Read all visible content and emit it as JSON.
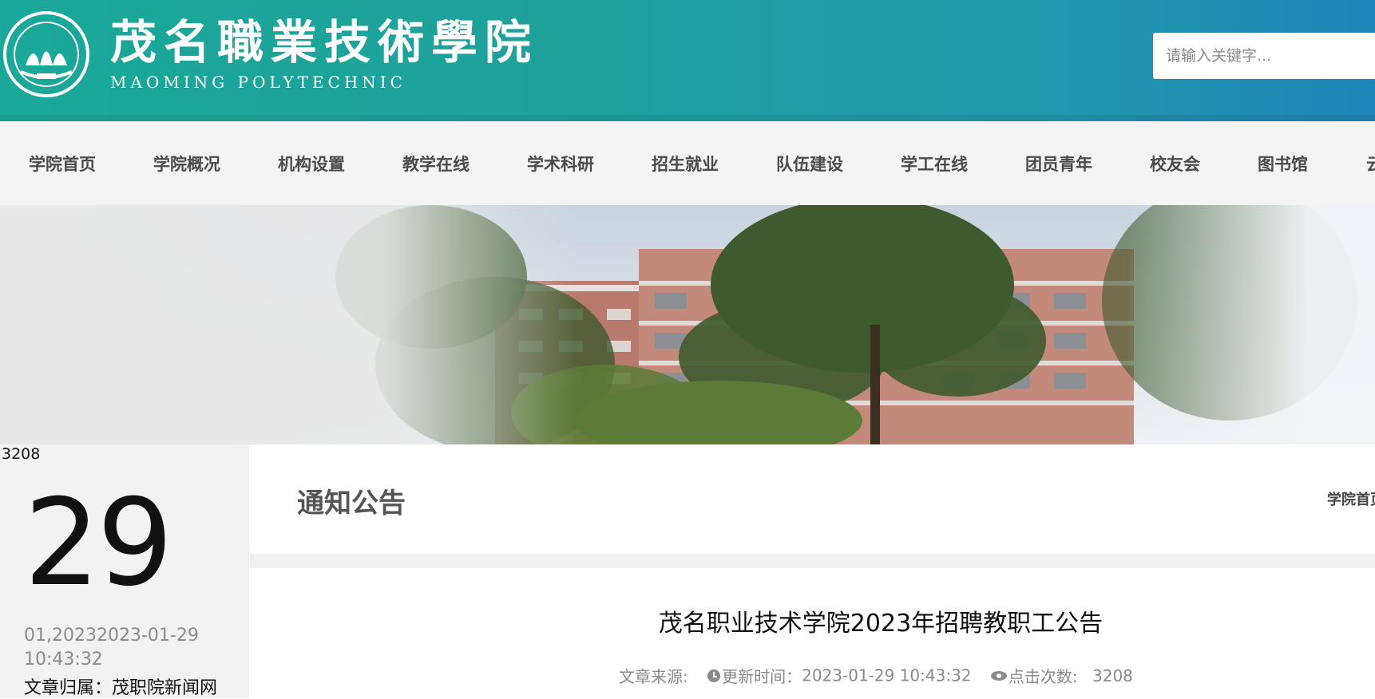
{
  "header": {
    "brand_cn": "茂名職業技術學院",
    "brand_en": "MAOMING POLYTECHNIC",
    "search_placeholder": "请输入关键字...",
    "gradient_start": "#1aa89a",
    "gradient_end": "#1f86b7"
  },
  "nav": {
    "items": [
      "学院首页",
      "学院概况",
      "机构设置",
      "教学在线",
      "学术科研",
      "招生就业",
      "队伍建设",
      "学工在线",
      "团员青年",
      "校友会",
      "图书馆",
      "云"
    ]
  },
  "sidebar": {
    "views": "3208",
    "day": "29",
    "date_text": "01,20232023-01-29 10:43:32",
    "belongs": "文章归属：茂职院新闻网"
  },
  "content": {
    "section_title": "通知公告",
    "breadcrumb": "学院首页",
    "article_title": "茂名职业技术学院2023年招聘教职工公告",
    "meta": {
      "source_label": "文章来源:",
      "updated_label": "更新时间：",
      "updated_value": "2023-01-29 10:43:32",
      "views_label": "点击次数:",
      "views_value": "3208"
    }
  }
}
